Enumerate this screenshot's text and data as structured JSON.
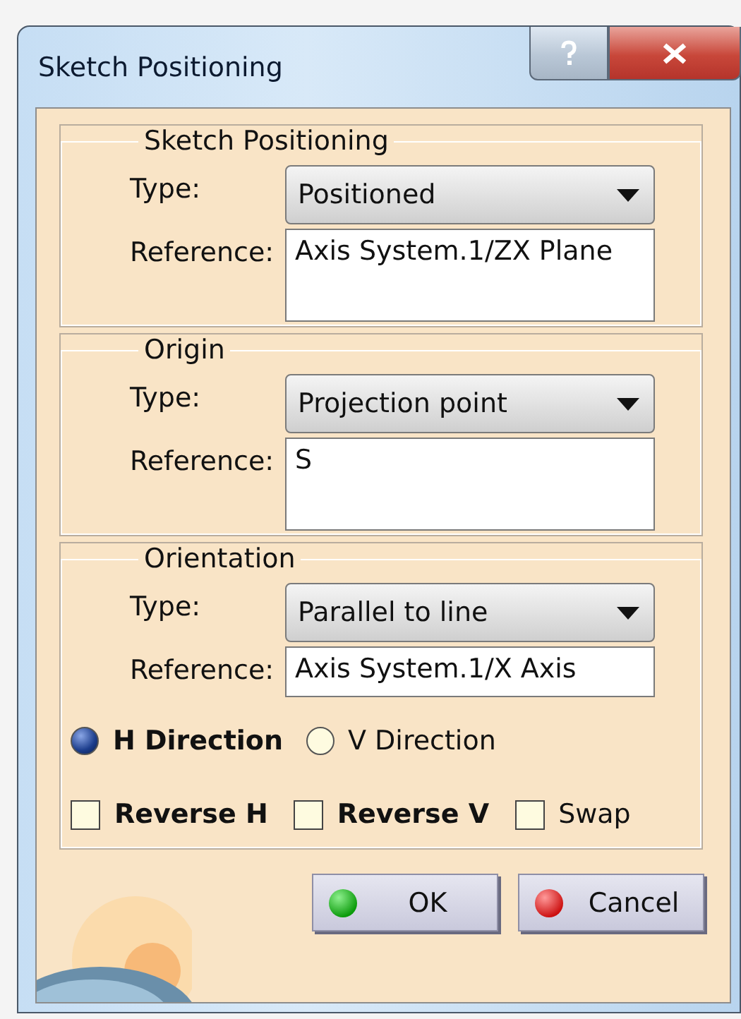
{
  "window": {
    "title": "Sketch Positioning"
  },
  "title_buttons": [
    {
      "kind": "help"
    },
    {
      "kind": "close"
    }
  ],
  "groups": [
    {
      "title": "Sketch Positioning",
      "type_label": "Type:",
      "type_value": "Positioned",
      "reference_label": "Reference:",
      "reference_value": "Axis System.1/ZX Plane",
      "reference_multiline": true
    },
    {
      "title": "Origin",
      "type_label": "Type:",
      "type_value": "Projection point",
      "reference_label": "Reference:",
      "reference_value": "S",
      "reference_multiline": true
    },
    {
      "title": "Orientation",
      "type_label": "Type:",
      "type_value": "Parallel to line",
      "reference_label": "Reference:",
      "reference_value": "Axis System.1/X Axis",
      "reference_multiline": false,
      "radios": [
        {
          "label": "H Direction",
          "selected": true
        },
        {
          "label": "V Direction",
          "selected": false
        }
      ],
      "checkboxes": [
        {
          "label": "Reverse H",
          "checked": false,
          "bold": true
        },
        {
          "label": "Reverse V",
          "checked": false,
          "bold": true
        },
        {
          "label": "Swap",
          "checked": false,
          "bold": false
        }
      ]
    }
  ],
  "buttons": [
    {
      "label": "OK",
      "kind": "ok"
    },
    {
      "label": "Cancel",
      "kind": "cancel"
    }
  ]
}
